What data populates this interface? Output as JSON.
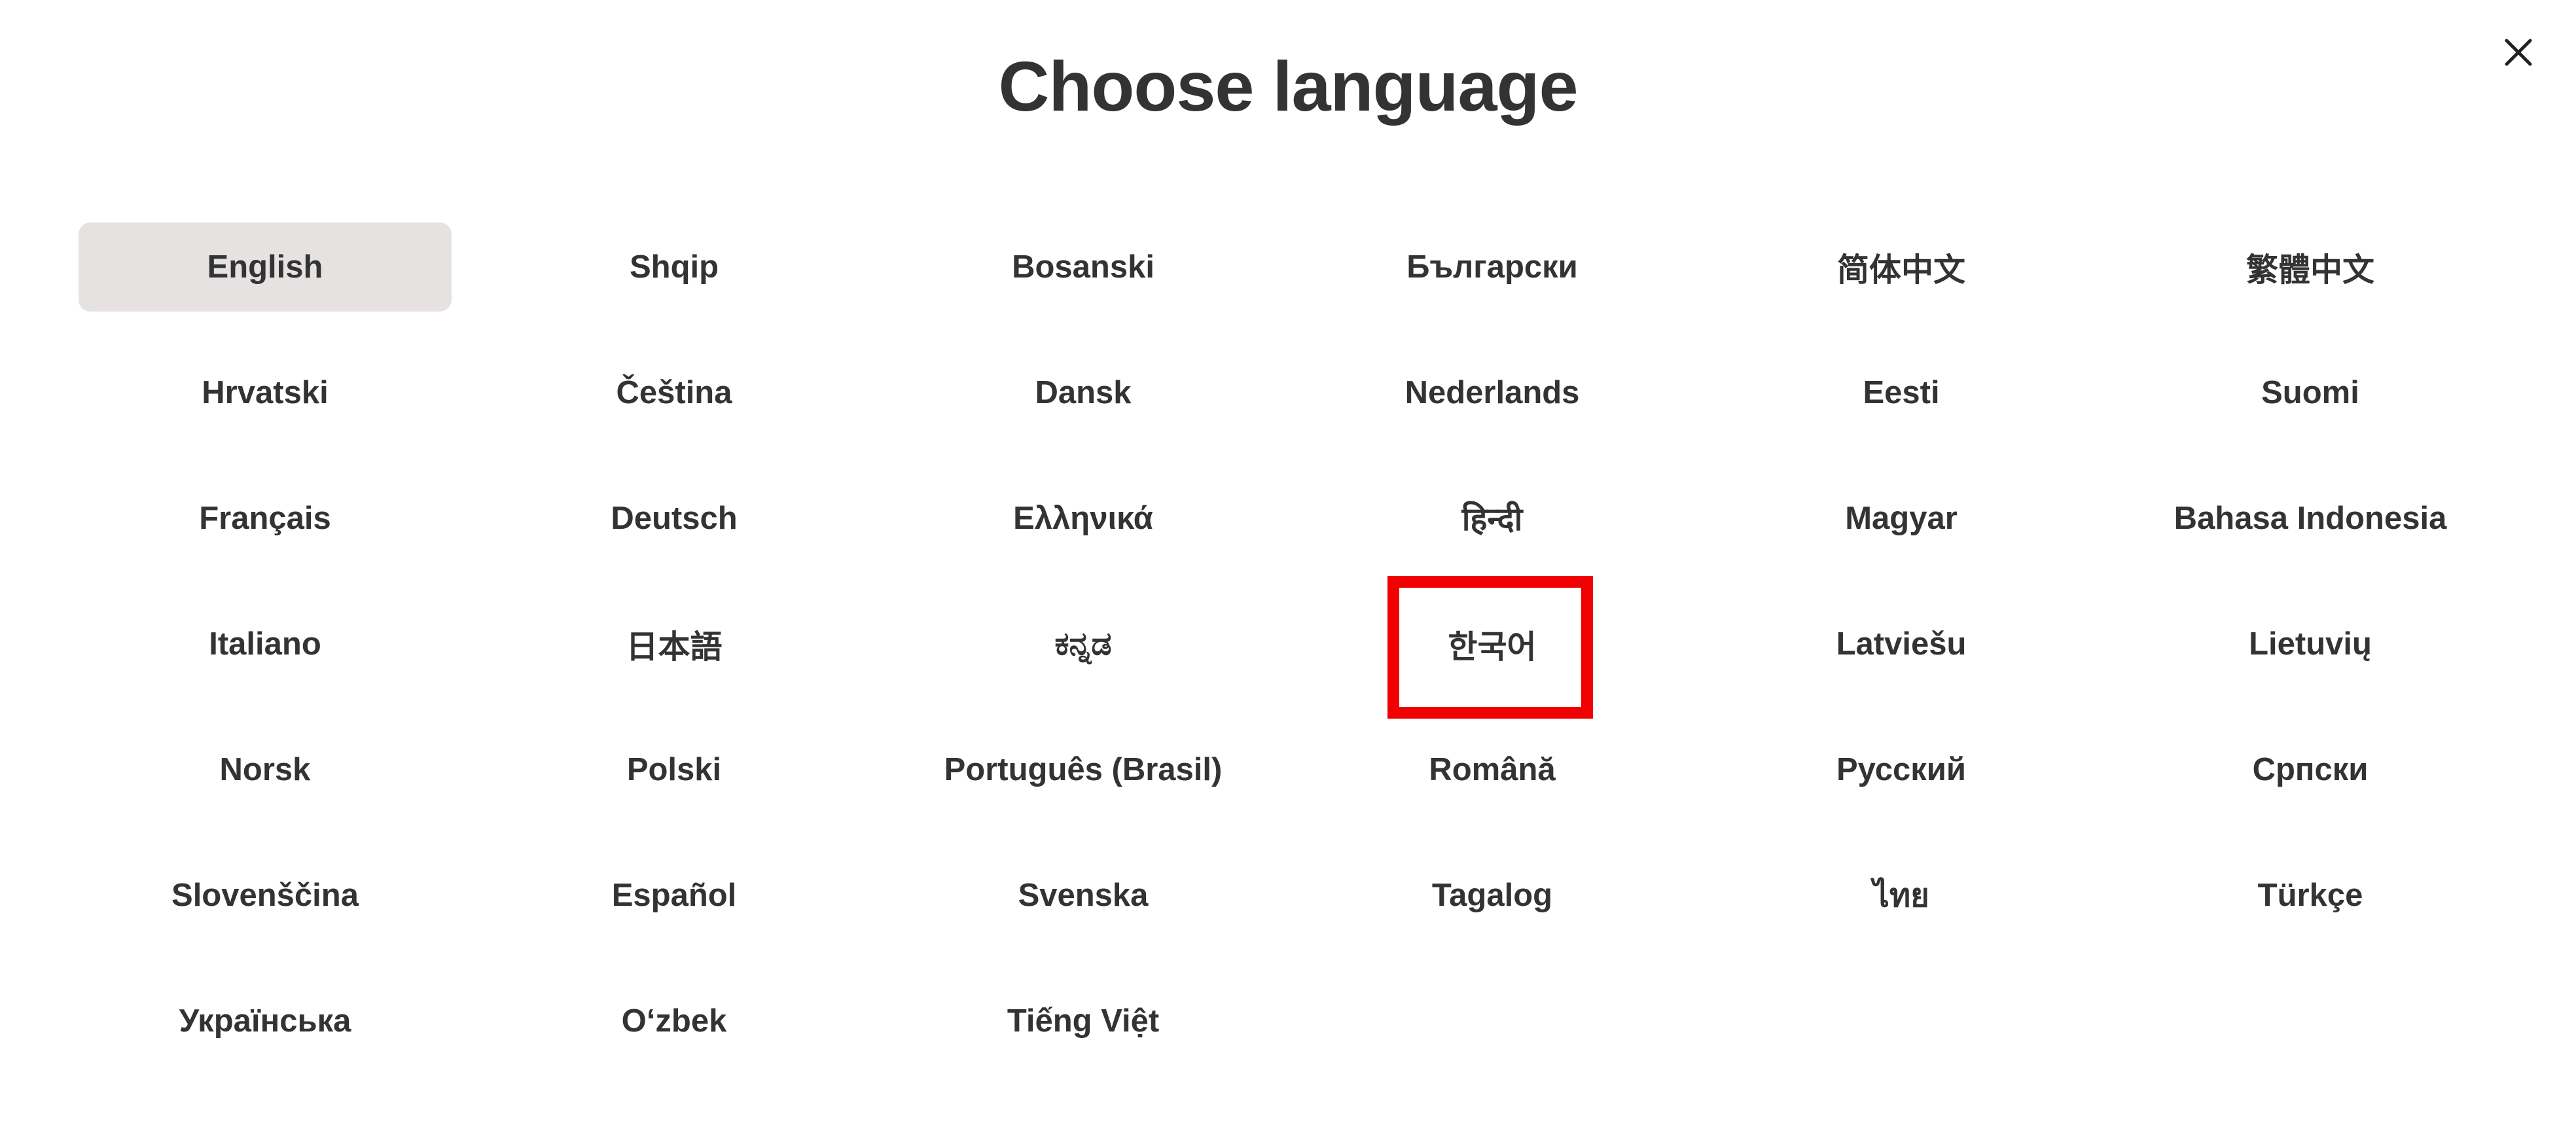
{
  "dialog": {
    "title": "Choose language",
    "close_icon": "close-icon"
  },
  "languages": [
    {
      "label": "English",
      "selected": true
    },
    {
      "label": "Shqip"
    },
    {
      "label": "Bosanski"
    },
    {
      "label": "Български"
    },
    {
      "label": "简体中文"
    },
    {
      "label": "繁體中文"
    },
    {
      "label": "Hrvatski"
    },
    {
      "label": "Čeština"
    },
    {
      "label": "Dansk"
    },
    {
      "label": "Nederlands"
    },
    {
      "label": "Eesti"
    },
    {
      "label": "Suomi"
    },
    {
      "label": "Français"
    },
    {
      "label": "Deutsch"
    },
    {
      "label": "Ελληνικά"
    },
    {
      "label": "हिन्दी"
    },
    {
      "label": "Magyar"
    },
    {
      "label": "Bahasa Indonesia"
    },
    {
      "label": "Italiano"
    },
    {
      "label": "日本語"
    },
    {
      "label": "ಕನ್ನಡ"
    },
    {
      "label": "한국어",
      "highlighted": true
    },
    {
      "label": "Latviešu"
    },
    {
      "label": "Lietuvių"
    },
    {
      "label": "Norsk"
    },
    {
      "label": "Polski"
    },
    {
      "label": "Português (Brasil)"
    },
    {
      "label": "Română"
    },
    {
      "label": "Русский"
    },
    {
      "label": "Српски"
    },
    {
      "label": "Slovenščina"
    },
    {
      "label": "Español"
    },
    {
      "label": "Svenska"
    },
    {
      "label": "Tagalog"
    },
    {
      "label": "ไทย"
    },
    {
      "label": "Türkçe"
    },
    {
      "label": "Українська"
    },
    {
      "label": "O‘zbek"
    },
    {
      "label": "Tiếng Việt"
    }
  ],
  "colors": {
    "text": "#333333",
    "selected_bg": "#e6e2e2",
    "highlight_border": "#f00000"
  }
}
